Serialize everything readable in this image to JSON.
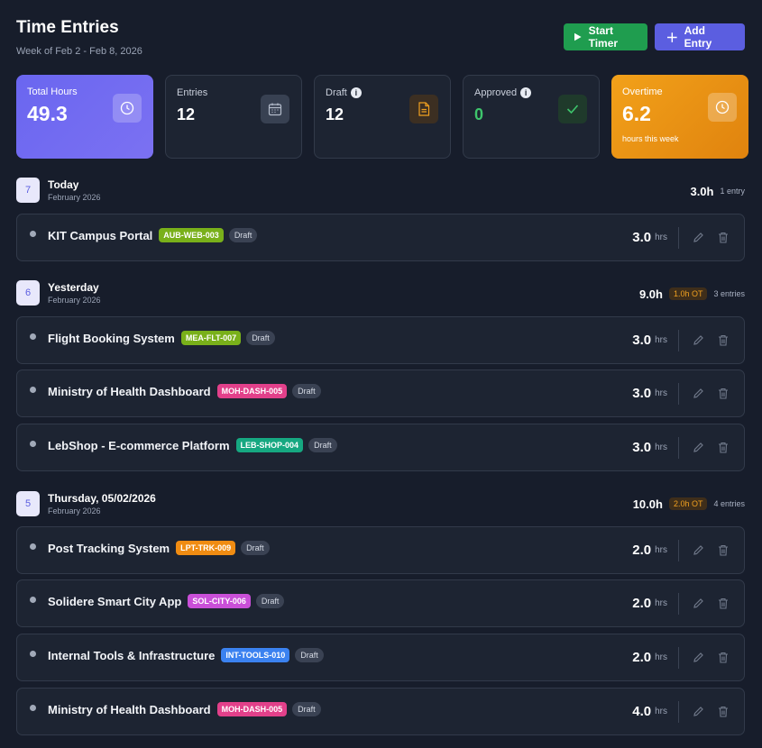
{
  "header": {
    "title": "Time Entries",
    "subtitle": "Week of Feb 2 - Feb 8, 2026",
    "start_timer_label": "Start Timer",
    "add_entry_label": "Add Entry"
  },
  "stats": {
    "total_hours": {
      "label": "Total Hours",
      "value": "49.3",
      "icon": "clock-icon"
    },
    "entries": {
      "label": "Entries",
      "value": "12",
      "icon": "calendar-icon"
    },
    "draft": {
      "label": "Draft",
      "value": "12",
      "icon": "document-icon"
    },
    "approved": {
      "label": "Approved",
      "value": "0",
      "icon": "check-icon"
    },
    "overtime": {
      "label": "Overtime",
      "value": "6.2",
      "sub": "hours this week",
      "icon": "clock-icon"
    }
  },
  "days": [
    {
      "day": "7",
      "name": "Today",
      "month": "February 2026",
      "hours": "3.0h",
      "ot": "",
      "count": "1 entry",
      "entries": [
        {
          "title": "KIT Campus Portal",
          "code": "AUB-WEB-003",
          "code_color": "#79b01a",
          "status": "Draft",
          "hours": "3.0",
          "unit": "hrs"
        }
      ]
    },
    {
      "day": "6",
      "name": "Yesterday",
      "month": "February 2026",
      "hours": "9.0h",
      "ot": "1.0h OT",
      "count": "3 entries",
      "entries": [
        {
          "title": "Flight Booking System",
          "code": "MEA-FLT-007",
          "code_color": "#79b01a",
          "status": "Draft",
          "hours": "3.0",
          "unit": "hrs"
        },
        {
          "title": "Ministry of Health Dashboard",
          "code": "MOH-DASH-005",
          "code_color": "#e2408a",
          "status": "Draft",
          "hours": "3.0",
          "unit": "hrs"
        },
        {
          "title": "LebShop - E-commerce Platform",
          "code": "LEB-SHOP-004",
          "code_color": "#16a881",
          "status": "Draft",
          "hours": "3.0",
          "unit": "hrs"
        }
      ]
    },
    {
      "day": "5",
      "name": "Thursday, 05/02/2026",
      "month": "February 2026",
      "hours": "10.0h",
      "ot": "2.0h OT",
      "count": "4 entries",
      "entries": [
        {
          "title": "Post Tracking System",
          "code": "LPT-TRK-009",
          "code_color": "#f08c12",
          "status": "Draft",
          "hours": "2.0",
          "unit": "hrs"
        },
        {
          "title": "Solidere Smart City App",
          "code": "SOL-CITY-006",
          "code_color": "#c94fd8",
          "status": "Draft",
          "hours": "2.0",
          "unit": "hrs"
        },
        {
          "title": "Internal Tools & Infrastructure",
          "code": "INT-TOOLS-010",
          "code_color": "#3b82f0",
          "status": "Draft",
          "hours": "2.0",
          "unit": "hrs"
        },
        {
          "title": "Ministry of Health Dashboard",
          "code": "MOH-DASH-005",
          "code_color": "#e2408a",
          "status": "Draft",
          "hours": "4.0",
          "unit": "hrs"
        }
      ]
    }
  ]
}
